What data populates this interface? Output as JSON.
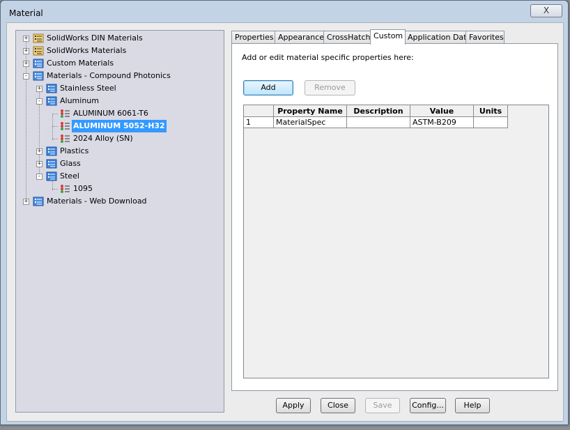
{
  "window": {
    "title": "Material",
    "close_glyph": "X"
  },
  "tree": {
    "nodes": [
      {
        "label": "SolidWorks DIN Materials",
        "expander": "+",
        "icon": "library-folder-icon"
      },
      {
        "label": "SolidWorks Materials",
        "expander": "+",
        "icon": "library-folder-icon"
      },
      {
        "label": "Custom Materials",
        "expander": "+",
        "icon": "library-blue-icon"
      },
      {
        "label": "Materials - Compound Photonics",
        "expander": "-",
        "icon": "library-blue-icon"
      },
      {
        "label": "Stainless Steel",
        "expander": "+",
        "icon": "category-icon"
      },
      {
        "label": "Aluminum",
        "expander": "-",
        "icon": "category-icon"
      },
      {
        "label": "ALUMINUM 6061-T6",
        "icon": "material-icon"
      },
      {
        "label": "ALUMINUM 5052-H32",
        "icon": "material-icon",
        "selected": true
      },
      {
        "label": "2024 Alloy (SN)",
        "icon": "material-icon"
      },
      {
        "label": "Plastics",
        "expander": "+",
        "icon": "category-icon"
      },
      {
        "label": "Glass",
        "expander": "+",
        "icon": "category-icon"
      },
      {
        "label": "Steel",
        "expander": "-",
        "icon": "category-icon"
      },
      {
        "label": "1095",
        "icon": "material-icon"
      },
      {
        "label": "Materials - Web Download",
        "expander": "+",
        "icon": "library-blue-icon"
      }
    ]
  },
  "tabs": [
    "Properties",
    "Appearance",
    "CrossHatch",
    "Custom",
    "Application Data",
    "Favorites"
  ],
  "active_tab": "Custom",
  "custom": {
    "hint": "Add or edit material specific properties here:",
    "add_label": "Add",
    "remove_label": "Remove",
    "columns": [
      "",
      "Property Name",
      "Description",
      "Value",
      "Units"
    ],
    "rows": [
      [
        "1",
        "MaterialSpec",
        "",
        "ASTM-B209",
        ""
      ]
    ]
  },
  "footer": {
    "apply_label": "Apply",
    "close_label": "Close",
    "save_label": "Save",
    "config_label": "Config...",
    "help_label": "Help"
  },
  "colors": {
    "selection": "#3399ff",
    "tree_bg": "#d9dae4",
    "frame": "#c3d3e6"
  }
}
